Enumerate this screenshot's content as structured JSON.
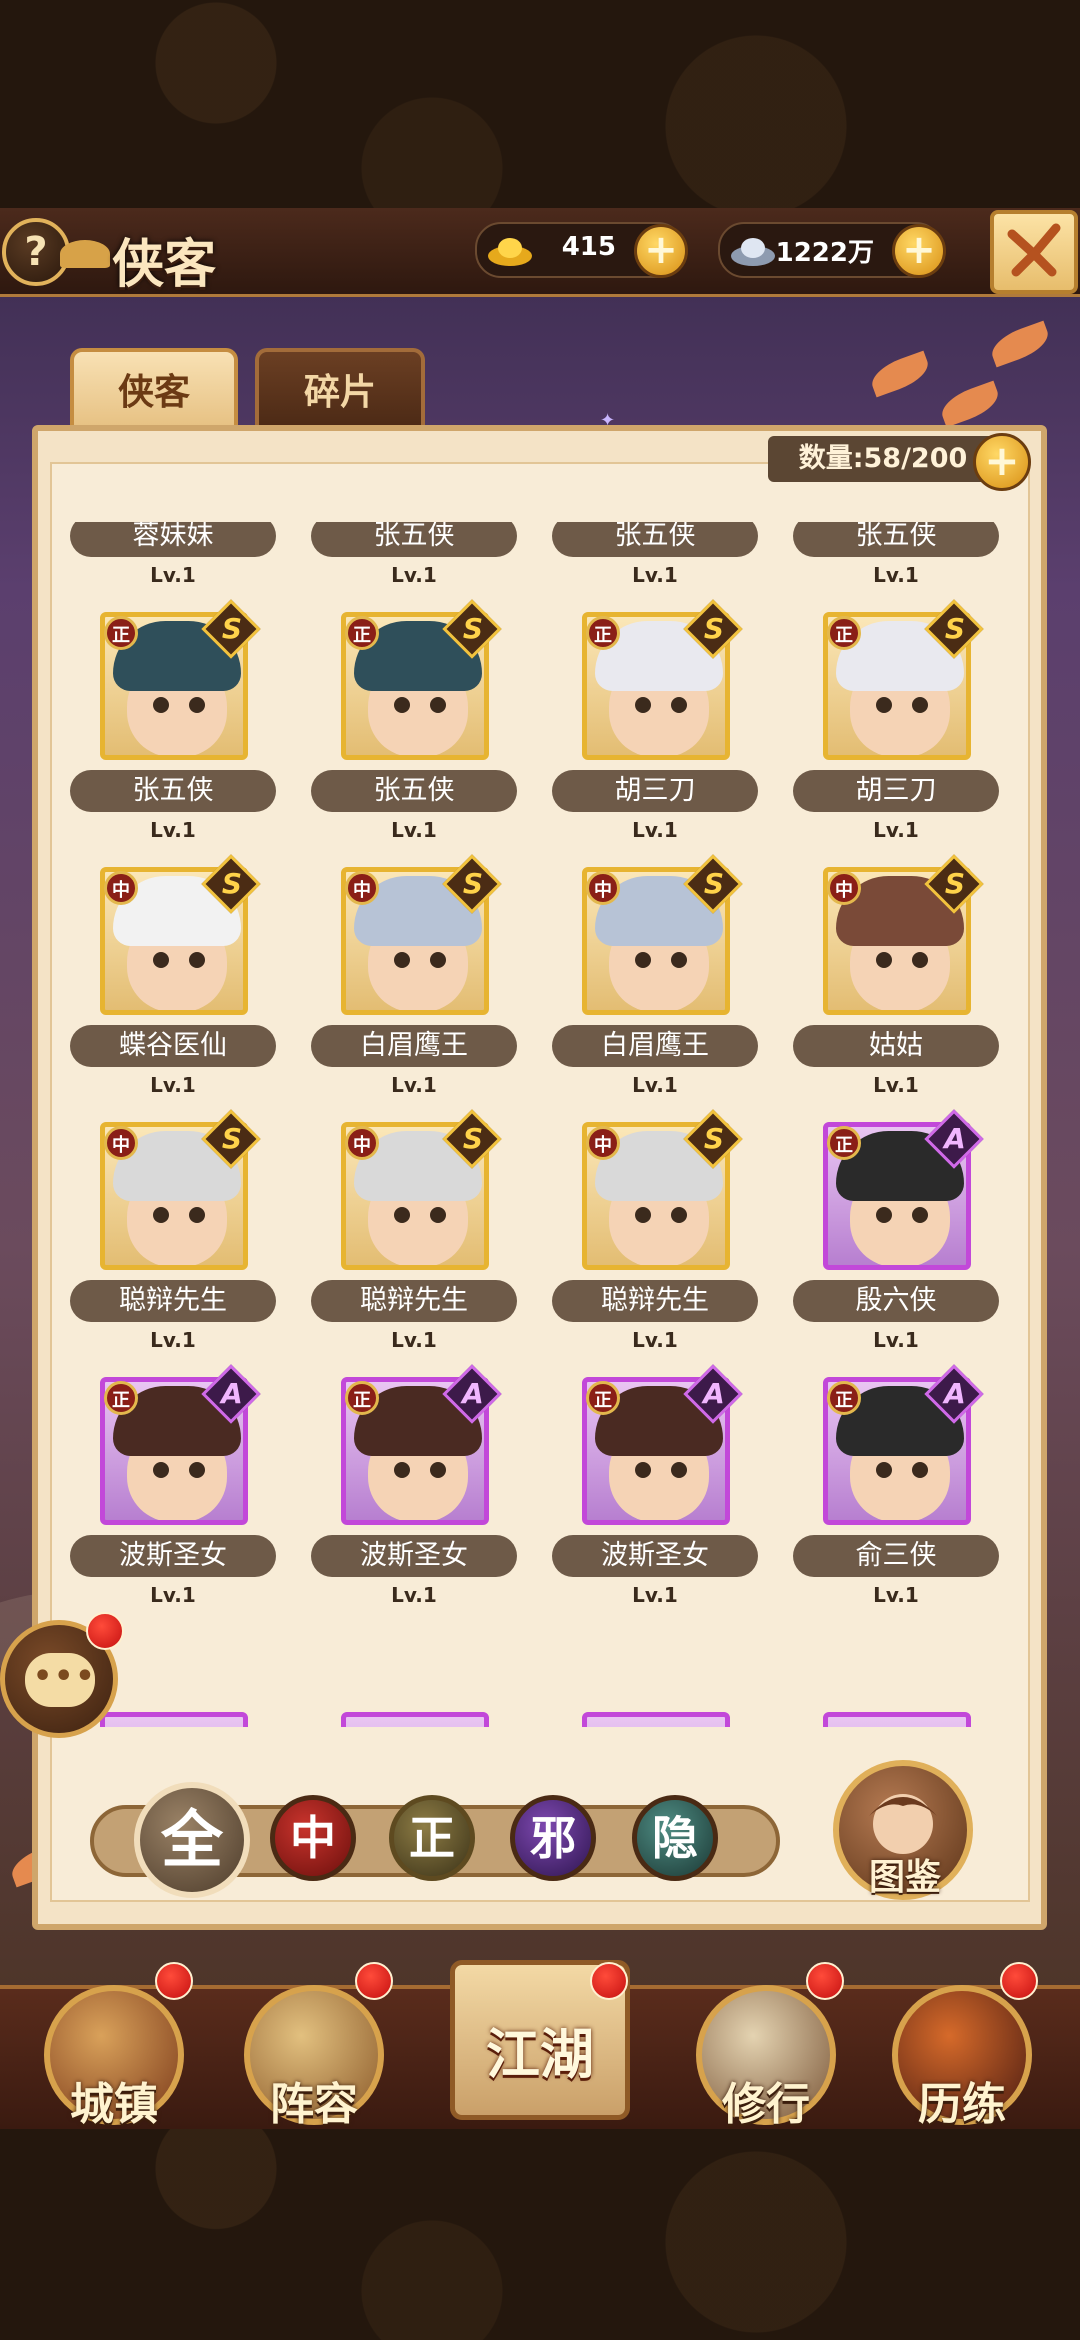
{
  "header": {
    "help_icon": "?",
    "title": "侠客",
    "currency": [
      {
        "icon": "gold-ingot-icon",
        "value": "415"
      },
      {
        "icon": "silver-ingot-icon",
        "value": "1222万"
      }
    ],
    "plus": "+"
  },
  "tabs": [
    {
      "label": "侠客",
      "active": true
    },
    {
      "label": "碎片",
      "active": false
    }
  ],
  "inventory": {
    "count_label": "数量:58/200",
    "plus": "+"
  },
  "heroes": [
    {
      "name": "蓉妹妹",
      "level": "Lv.1",
      "faction": "",
      "grade": "",
      "rarity": "gold",
      "hair": "#6b3a1e",
      "partial": true
    },
    {
      "name": "张五侠",
      "level": "Lv.1",
      "faction": "",
      "grade": "",
      "rarity": "gold",
      "hair": "#2f4f5a",
      "partial": true
    },
    {
      "name": "张五侠",
      "level": "Lv.1",
      "faction": "",
      "grade": "",
      "rarity": "gold",
      "hair": "#2f4f5a",
      "partial": true
    },
    {
      "name": "张五侠",
      "level": "Lv.1",
      "faction": "",
      "grade": "",
      "rarity": "gold",
      "hair": "#2f4f5a",
      "partial": true
    },
    {
      "name": "张五侠",
      "level": "Lv.1",
      "faction": "正",
      "grade": "S",
      "rarity": "gold",
      "hair": "#2f4f5a"
    },
    {
      "name": "张五侠",
      "level": "Lv.1",
      "faction": "正",
      "grade": "S",
      "rarity": "gold",
      "hair": "#2f4f5a"
    },
    {
      "name": "胡三刀",
      "level": "Lv.1",
      "faction": "正",
      "grade": "S",
      "rarity": "gold",
      "hair": "#e9e9ef"
    },
    {
      "name": "胡三刀",
      "level": "Lv.1",
      "faction": "正",
      "grade": "S",
      "rarity": "gold",
      "hair": "#e9e9ef"
    },
    {
      "name": "蝶谷医仙",
      "level": "Lv.1",
      "faction": "中",
      "grade": "S",
      "rarity": "gold",
      "hair": "#f2f2f2"
    },
    {
      "name": "白眉鹰王",
      "level": "Lv.1",
      "faction": "中",
      "grade": "S",
      "rarity": "gold",
      "hair": "#b7c3d6"
    },
    {
      "name": "白眉鹰王",
      "level": "Lv.1",
      "faction": "中",
      "grade": "S",
      "rarity": "gold",
      "hair": "#b7c3d6"
    },
    {
      "name": "姑姑",
      "level": "Lv.1",
      "faction": "中",
      "grade": "S",
      "rarity": "gold",
      "hair": "#7a4a38"
    },
    {
      "name": "聪辩先生",
      "level": "Lv.1",
      "faction": "中",
      "grade": "S",
      "rarity": "gold",
      "hair": "#d9d9d9"
    },
    {
      "name": "聪辩先生",
      "level": "Lv.1",
      "faction": "中",
      "grade": "S",
      "rarity": "gold",
      "hair": "#d9d9d9"
    },
    {
      "name": "聪辩先生",
      "level": "Lv.1",
      "faction": "中",
      "grade": "S",
      "rarity": "gold",
      "hair": "#d9d9d9"
    },
    {
      "name": "殷六侠",
      "level": "Lv.1",
      "faction": "正",
      "grade": "A",
      "rarity": "purple",
      "hair": "#2a2a2a"
    },
    {
      "name": "波斯圣女",
      "level": "Lv.1",
      "faction": "正",
      "grade": "A",
      "rarity": "purple",
      "hair": "#4a2a22"
    },
    {
      "name": "波斯圣女",
      "level": "Lv.1",
      "faction": "正",
      "grade": "A",
      "rarity": "purple",
      "hair": "#4a2a22"
    },
    {
      "name": "波斯圣女",
      "level": "Lv.1",
      "faction": "正",
      "grade": "A",
      "rarity": "purple",
      "hair": "#4a2a22"
    },
    {
      "name": "俞三侠",
      "level": "Lv.1",
      "faction": "正",
      "grade": "A",
      "rarity": "purple",
      "hair": "#2a2a2a"
    }
  ],
  "filters": [
    {
      "id": "all",
      "label": "全"
    },
    {
      "id": "mid",
      "label": "中"
    },
    {
      "id": "just",
      "label": "正"
    },
    {
      "id": "evil",
      "label": "邪"
    },
    {
      "id": "hidden",
      "label": "隐"
    }
  ],
  "codex": {
    "label": "图鉴"
  },
  "chat": {
    "icon": "chat-bubble-icon",
    "dots": "•••"
  },
  "nav": [
    {
      "label": "城镇"
    },
    {
      "label": "阵容"
    },
    {
      "label": "江湖"
    },
    {
      "label": "修行"
    },
    {
      "label": "历练"
    }
  ],
  "colors": {
    "gold_frame": "#e7b431",
    "purple_frame": "#c248d9",
    "name_plate": "#6e5a48",
    "panel": "#f4e3c6"
  }
}
